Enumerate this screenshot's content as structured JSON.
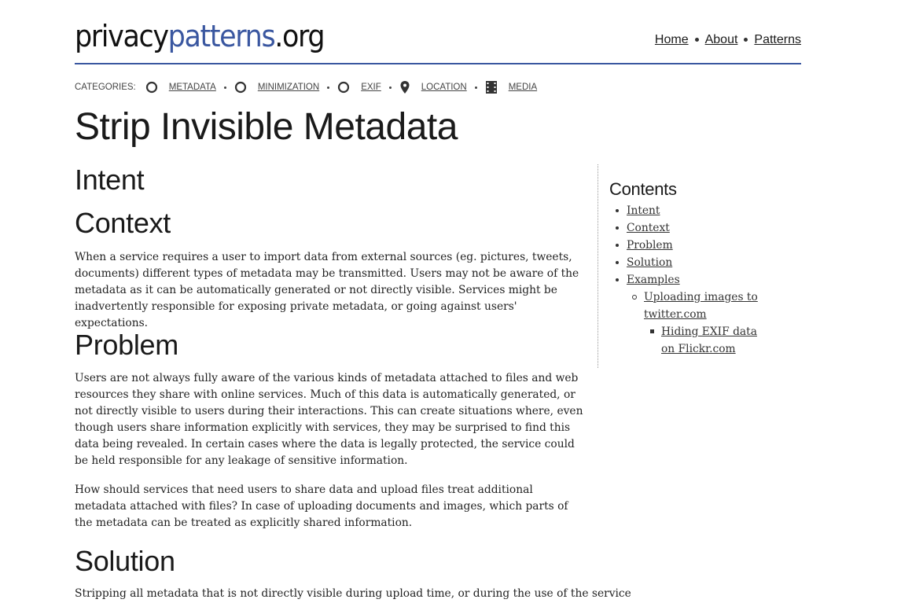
{
  "header": {
    "logo_part1": "privacy",
    "logo_part2": "patterns",
    "logo_part3": ".org",
    "nav": [
      {
        "label": "Home"
      },
      {
        "label": "About"
      },
      {
        "label": "Patterns"
      }
    ]
  },
  "categories": {
    "label": "CATEGORIES:",
    "items": [
      {
        "label": "METADATA",
        "icon": "circle-icon"
      },
      {
        "label": "MINIMIZATION",
        "icon": "circle-icon"
      },
      {
        "label": "EXIF",
        "icon": "circle-icon"
      },
      {
        "label": "LOCATION",
        "icon": "map-pin-icon"
      },
      {
        "label": "MEDIA",
        "icon": "film-icon"
      }
    ]
  },
  "page": {
    "title": "Strip Invisible Metadata"
  },
  "sections": {
    "intent": {
      "heading": "Intent"
    },
    "context": {
      "heading": "Context",
      "text": "When a service requires a user to import data from external sources (eg. pictures, tweets, documents) different types of metadata may be transmitted. Users may not be aware of the metadata as it can be automatically generated or not directly visible. Services might be inadvertently responsible for exposing private metadata, or going against users' expectations."
    },
    "problem": {
      "heading": "Problem",
      "text1": "Users are not always fully aware of the various kinds of metadata attached to files and web resources they share with online services. Much of this data is automatically generated, or not directly visible to users during their interactions. This can create situations where, even though users share information explicitly with services, they may be surprised to find this data being revealed. In certain cases where the data is legally protected, the service could be held responsible for any leakage of sensitive information.",
      "text2": "How should services that need users to share data and upload files treat additional metadata attached with files? In case of uploading documents and images, which parts of the metadata can be treated as explicitly shared information."
    },
    "solution": {
      "heading": "Solution",
      "text": "Stripping all metadata that is not directly visible during upload time, or during the use of the service"
    }
  },
  "toc": {
    "title": "Contents",
    "items": [
      {
        "label": "Intent"
      },
      {
        "label": "Context"
      },
      {
        "label": "Problem"
      },
      {
        "label": "Solution"
      },
      {
        "label": "Examples"
      }
    ],
    "sub_item": "Uploading images to twitter.com",
    "sub_sub_item": "Hiding EXIF data on Flickr.com"
  },
  "colors": {
    "brand": "#3a57a0",
    "text": "#1a1a1a"
  }
}
